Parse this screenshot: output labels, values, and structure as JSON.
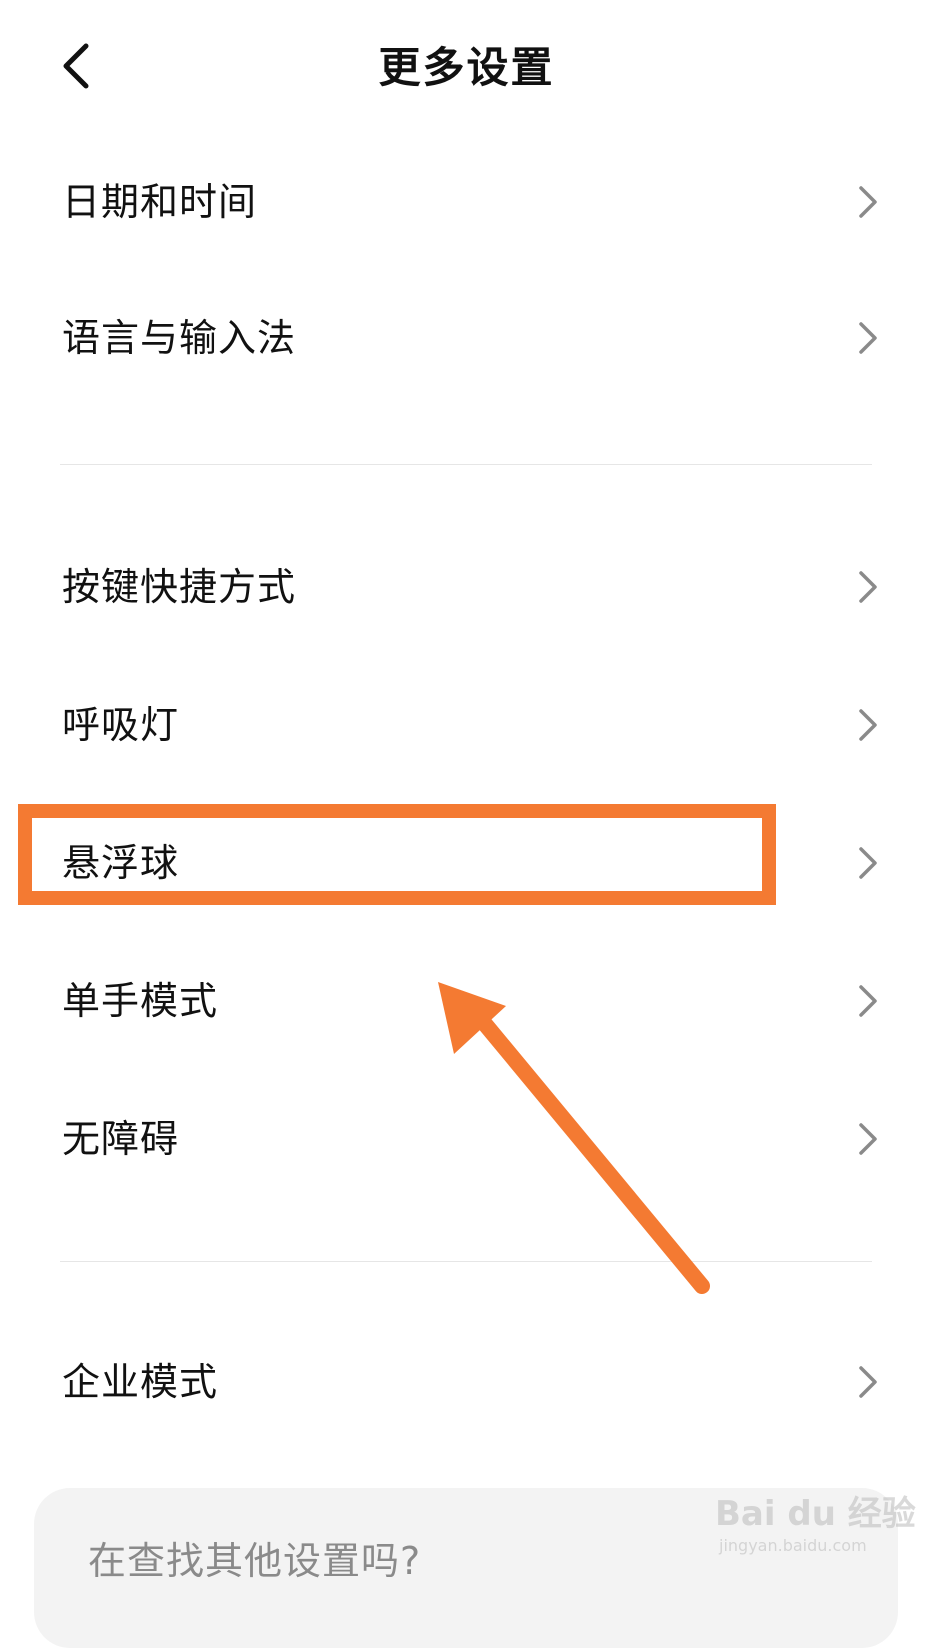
{
  "header": {
    "title": "更多设置",
    "back_icon": "chevron-left-icon"
  },
  "groups": [
    {
      "items": [
        {
          "label": "日期和时间"
        },
        {
          "label": "语言与输入法"
        }
      ]
    },
    {
      "items": [
        {
          "label": "按键快捷方式"
        },
        {
          "label": "呼吸灯"
        },
        {
          "label": "悬浮球"
        },
        {
          "label": "单手模式"
        },
        {
          "label": "无障碍"
        }
      ]
    },
    {
      "items": [
        {
          "label": "企业模式"
        }
      ]
    }
  ],
  "highlighted_item": "悬浮球",
  "search_card": {
    "text": "在查找其他设置吗?"
  },
  "watermark": {
    "brand": "Bai du 经验",
    "url": "jingyan.baidu.com"
  },
  "colors": {
    "annotation": "#f47a32",
    "divider": "#e6e6e6",
    "chevron": "#8a8a8a",
    "card": "#f3f3f3"
  }
}
